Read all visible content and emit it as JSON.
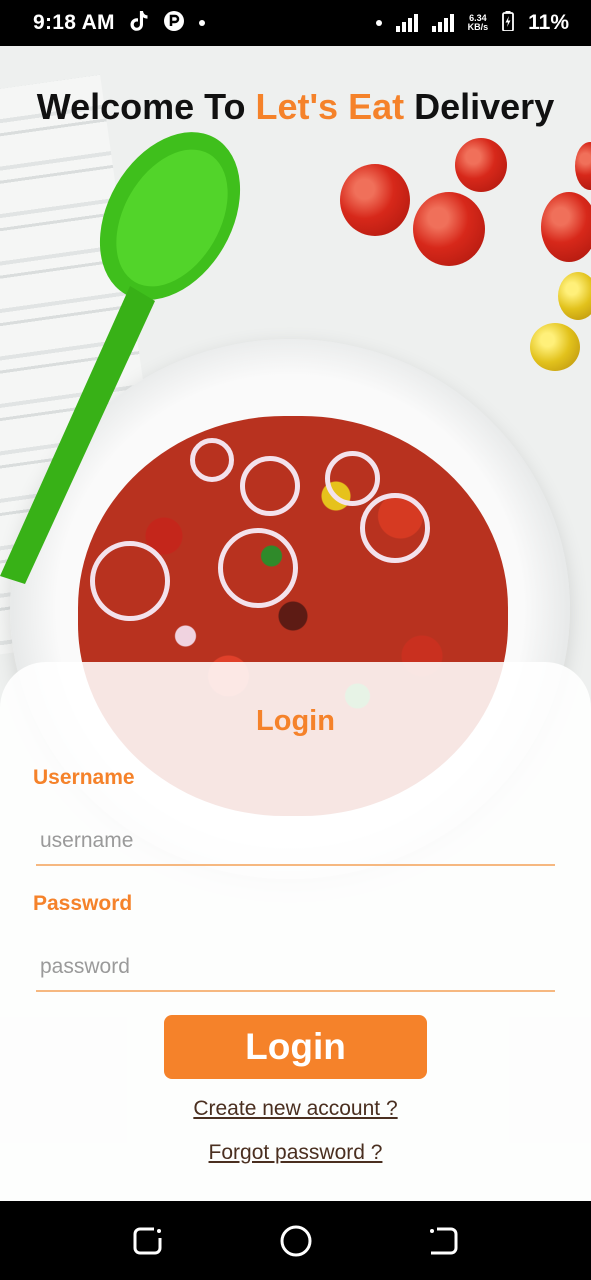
{
  "status_bar": {
    "time": "9:18 AM",
    "net_speed_value": "6.34",
    "net_speed_unit": "KB/s",
    "battery": "11%"
  },
  "header": {
    "title_prefix": "Welcome To ",
    "title_brand": "Let's Eat",
    "title_suffix": " Delivery"
  },
  "login": {
    "heading": "Login",
    "username_label": "Username",
    "username_placeholder": "username",
    "username_value": "",
    "password_label": "Password",
    "password_placeholder": "password",
    "password_value": "",
    "submit_label": "Login",
    "create_account_link": "Create new account ?",
    "forgot_password_link": "Forgot password ?"
  },
  "nav_bar": {
    "recent_icon": "recent-apps-icon",
    "home_icon": "home-icon",
    "back_icon": "back-icon"
  },
  "colors": {
    "accent": "#f5822a",
    "status_bar_bg": "#000000",
    "nav_bar_bg": "#000000"
  }
}
